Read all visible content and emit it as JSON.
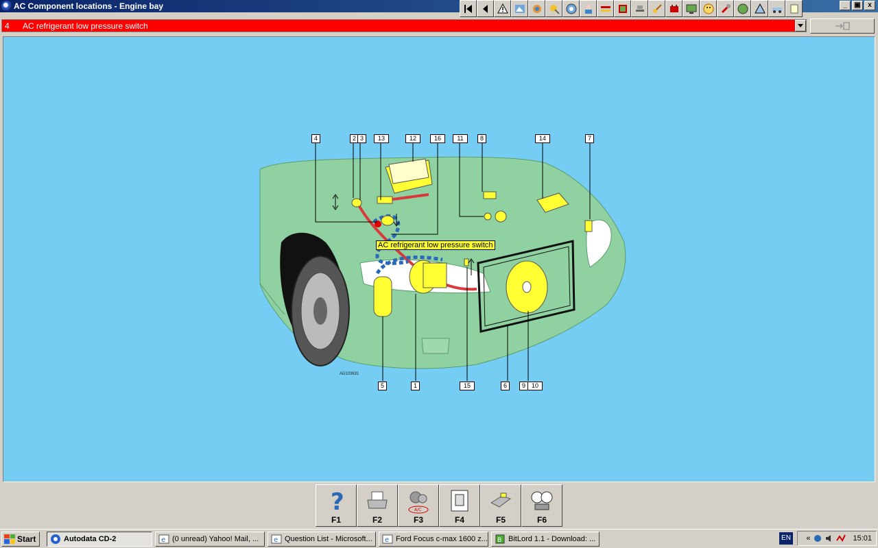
{
  "window": {
    "title": "AC Component locations - Engine bay",
    "controls": [
      "_",
      "▣",
      "x"
    ]
  },
  "selector": {
    "number": "4",
    "label": "AC refrigerant low pressure switch"
  },
  "diagram": {
    "tooltip": "AC refrigerant low pressure switch",
    "ref_code": "AD103631",
    "callouts": [
      "4",
      "2",
      "3",
      "13",
      "12",
      "16",
      "11",
      "8",
      "14",
      "7",
      "5",
      "1",
      "15",
      "6",
      "9",
      "10"
    ],
    "colors": {
      "background": "#75cdf3",
      "car": "#8fd1a0",
      "highlight": "#ffff33",
      "pipe_high": "#d9393b",
      "pipe_low": "#2a68b8"
    }
  },
  "function_keys": [
    {
      "label": "F1",
      "icon": "help-icon"
    },
    {
      "label": "F2",
      "icon": "printer-icon"
    },
    {
      "label": "F3",
      "icon": "ac-compressor-icon",
      "sub": "A/C"
    },
    {
      "label": "F4",
      "icon": "document-icon"
    },
    {
      "label": "F5",
      "icon": "component-icon"
    },
    {
      "label": "F6",
      "icon": "gauge-icon"
    }
  ],
  "taskbar": {
    "start": "Start",
    "tasks": [
      {
        "label": "Autodata CD-2",
        "active": true
      },
      {
        "label": "(0 unread) Yahoo! Mail, ..."
      },
      {
        "label": "Question List - Microsoft..."
      },
      {
        "label": "Ford Focus c-max 1600 z..."
      },
      {
        "label": "BitLord 1.1 - Download: ..."
      }
    ],
    "language": "EN",
    "tray_expand": "«",
    "clock": "15:01"
  }
}
